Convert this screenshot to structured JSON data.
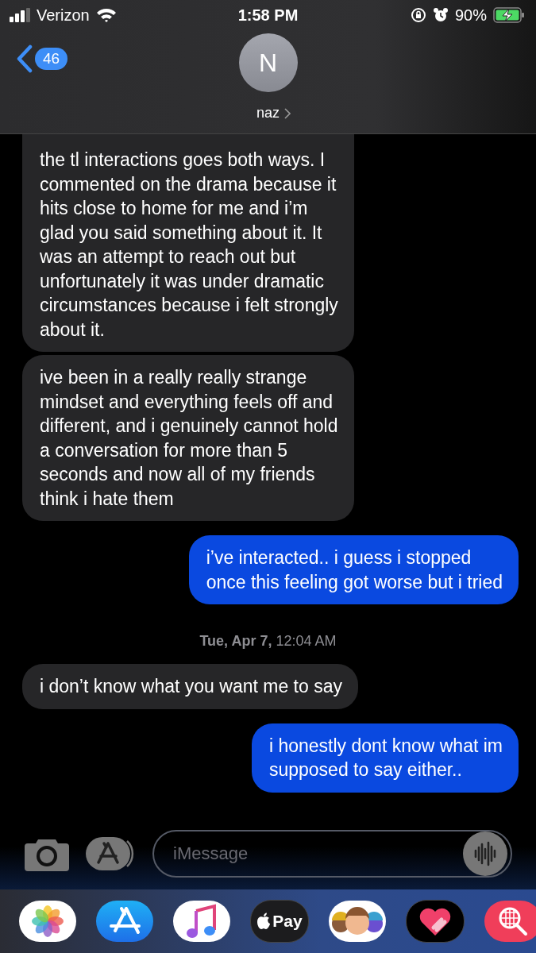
{
  "status_bar": {
    "carrier": "Verizon",
    "time": "1:58 PM",
    "battery": "90%"
  },
  "header": {
    "back_count": "46",
    "avatar_initial": "N",
    "contact_name": "naz"
  },
  "messages": [
    {
      "kind": "received",
      "text": "the tl interactions goes both ways. I\ncommented on the drama because it\nhits close to home for me and i’m\nglad you said something about it. It\nwas an attempt to reach out but\nunfortunately it was under dramatic\ncircumstances because i felt strongly\nabout it."
    },
    {
      "kind": "received",
      "text": "ive been in a really really strange\nmindset and everything feels off and\ndifferent, and i genuinely cannot hold\na conversation for more than 5\nseconds and now all of my friends\nthink i hate them"
    },
    {
      "kind": "sent",
      "text": "i’ve interacted.. i guess i stopped\nonce this feeling got worse but i tried"
    },
    {
      "kind": "timestamp",
      "text": "**Tue, Apr 7,** 12:04 AM"
    },
    {
      "kind": "received",
      "text": "i don’t know what you want me to say"
    },
    {
      "kind": "sent",
      "text": "i honestly dont know what im\nsupposed to say either.."
    }
  ],
  "composer": {
    "placeholder": "iMessage"
  },
  "apps": [
    {
      "kind": "photos"
    },
    {
      "kind": "appstore"
    },
    {
      "kind": "music"
    },
    {
      "kind": "pay",
      "label": "Pay"
    },
    {
      "kind": "memoji"
    },
    {
      "kind": "heart"
    },
    {
      "kind": "search"
    }
  ]
}
